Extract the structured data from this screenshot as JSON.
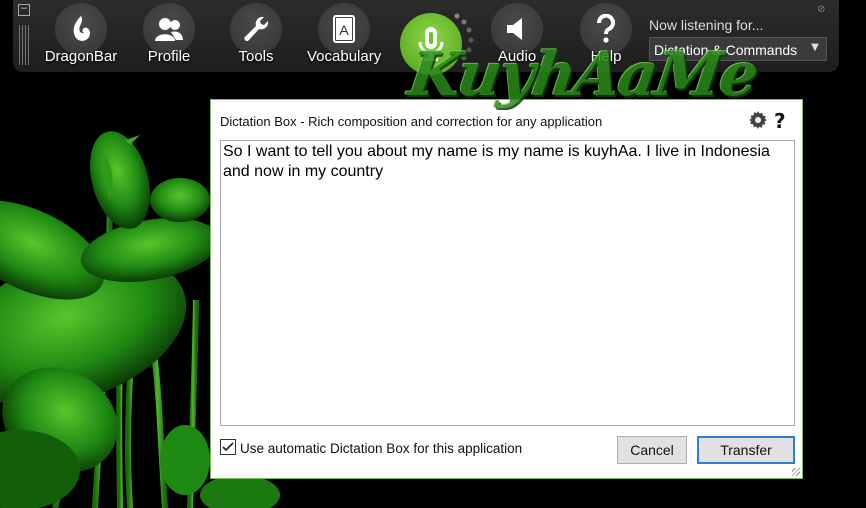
{
  "dragonbar": {
    "minimize_glyph": "−",
    "pin_glyph": "⊘",
    "buttons": [
      {
        "label": "DragonBar",
        "icon": "dragon-flame-icon"
      },
      {
        "label": "Profile",
        "icon": "users-icon"
      },
      {
        "label": "Tools",
        "icon": "wrench-icon"
      },
      {
        "label": "Vocabulary",
        "icon": "book-a-icon"
      },
      {
        "label": "Audio",
        "icon": "speaker-icon"
      },
      {
        "label": "Help",
        "icon": "question-icon"
      }
    ],
    "mic_icon": "microphone-icon",
    "mic_color": "#6cc02e",
    "listening_label": "Now listening for...",
    "mode_value": "Dictation & Commands"
  },
  "watermark": "KuyhAaMe",
  "dictation": {
    "title": "Dictation Box - Rich composition and correction for any application",
    "help_glyph": "?",
    "text": "So I want to tell you about my name is my name is kuyhAa. I live in Indonesia and now in my country",
    "auto_checkbox_label": "Use automatic Dictation Box for this application",
    "auto_checked": true,
    "cancel_label": "Cancel",
    "transfer_label": "Transfer",
    "accent": "#2d7fd6"
  }
}
